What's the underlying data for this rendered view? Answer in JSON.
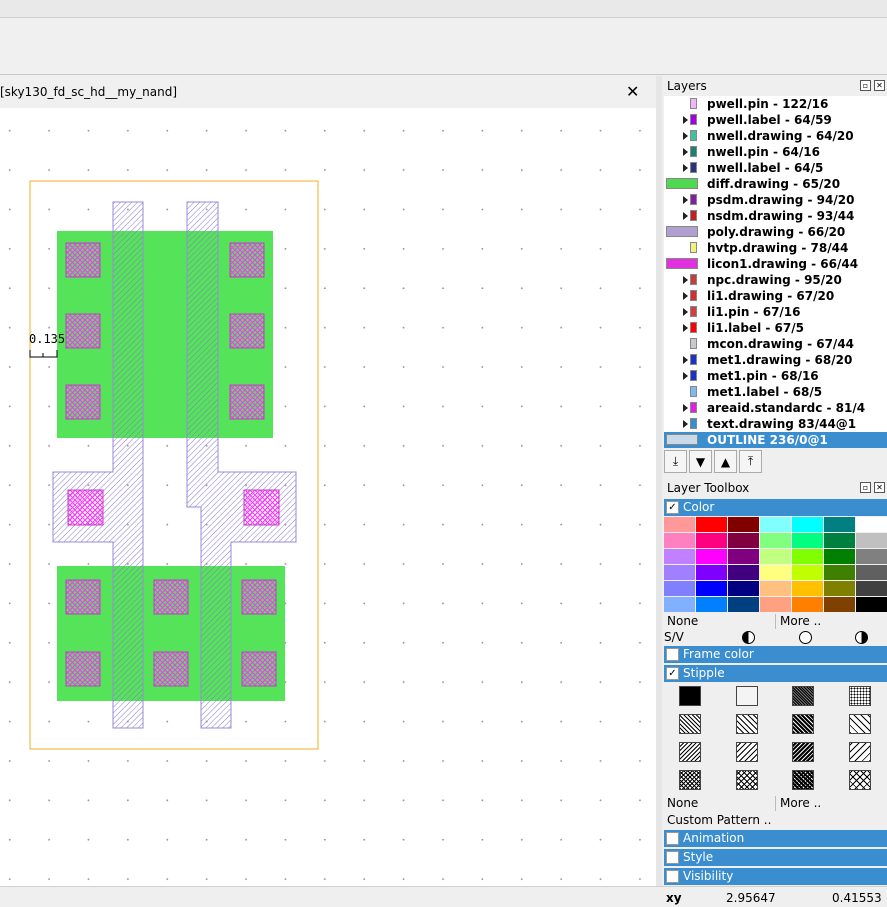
{
  "tab": {
    "title": "[sky130_fd_sc_hd__my_nand]",
    "close": "✕"
  },
  "canvas": {
    "ruler_label": "0.135"
  },
  "layers_panel": {
    "title": "Layers",
    "items": [
      {
        "label": "pwell.pin - 122/16",
        "color": "#f0b8f0",
        "expanded": false
      },
      {
        "label": "pwell.label - 64/59",
        "color": "#a000e0",
        "expanded": true
      },
      {
        "label": "nwell.drawing - 64/20",
        "color": "#40c0a0",
        "expanded": true
      },
      {
        "label": "nwell.pin - 64/16",
        "color": "#208070",
        "expanded": true
      },
      {
        "label": "nwell.label - 64/5",
        "color": "#303080",
        "expanded": true
      },
      {
        "label": "diff.drawing - 65/20",
        "color": "#50d850",
        "expanded": false
      },
      {
        "label": "psdm.drawing - 94/20",
        "color": "#8020a0",
        "expanded": true
      },
      {
        "label": "nsdm.drawing - 93/44",
        "color": "#c02020",
        "expanded": true
      },
      {
        "label": "poly.drawing - 66/20",
        "color": "#b0a0d0",
        "expanded": false
      },
      {
        "label": "hvtp.drawing - 78/44",
        "color": "#f0f080",
        "expanded": false
      },
      {
        "label": "licon1.drawing - 66/44",
        "color": "#e030e0",
        "expanded": false
      },
      {
        "label": "npc.drawing - 95/20",
        "color": "#c04040",
        "expanded": true
      },
      {
        "label": "li1.drawing - 67/20",
        "color": "#d03030",
        "expanded": true
      },
      {
        "label": "li1.pin - 67/16",
        "color": "#d04040",
        "expanded": true
      },
      {
        "label": "li1.label - 67/5",
        "color": "#ff0000",
        "expanded": true
      },
      {
        "label": "mcon.drawing - 67/44",
        "color": "#c8c8d0",
        "expanded": false
      },
      {
        "label": "met1.drawing - 68/20",
        "color": "#2030c0",
        "expanded": true
      },
      {
        "label": "met1.pin - 68/16",
        "color": "#2030c0",
        "expanded": true
      },
      {
        "label": "met1.label - 68/5",
        "color": "#80b8f0",
        "expanded": false
      },
      {
        "label": "areaid.standardc - 81/4",
        "color": "#e020e0",
        "expanded": true
      },
      {
        "label": "text.drawing 83/44@1",
        "color": "#3090d0",
        "expanded": true
      },
      {
        "label": "OUTLINE 236/0@1",
        "color": "#c8daea",
        "expanded": false,
        "selected": true
      }
    ]
  },
  "nav": [
    "move-to-bottom",
    "move-down",
    "move-up",
    "move-to-top"
  ],
  "toolbox": {
    "title": "Layer Toolbox",
    "color_label": "Color",
    "color_checked": true,
    "palette": [
      [
        "#ff9999",
        "#ff0000",
        "#800000",
        "#80ffff",
        "#00ffff",
        "#008080",
        "#ffffff"
      ],
      [
        "#ff80c0",
        "#ff0080",
        "#800040",
        "#80ff80",
        "#00ff80",
        "#008040",
        "#c0c0c0"
      ],
      [
        "#c080ff",
        "#ff00ff",
        "#800080",
        "#c0ff80",
        "#80ff00",
        "#008000",
        "#808080"
      ],
      [
        "#a080ff",
        "#8000ff",
        "#400080",
        "#ffff80",
        "#c0ff00",
        "#408000",
        "#606060"
      ],
      [
        "#8080ff",
        "#0000ff",
        "#000080",
        "#ffc080",
        "#ffc000",
        "#808000",
        "#404040"
      ],
      [
        "#80b0ff",
        "#0080ff",
        "#004080",
        "#ffa080",
        "#ff8000",
        "#804000",
        "#000000"
      ]
    ],
    "none_label": "None",
    "more_label": "More ..",
    "sv_label": "S/V",
    "frame_color_label": "Frame color",
    "frame_color_checked": false,
    "stipple_label": "Stipple",
    "stipple_checked": true,
    "stipple_none_label": "None",
    "stipple_more_label": "More ..",
    "custom_pattern_label": "Custom Pattern ..",
    "animation_label": "Animation",
    "style_label": "Style",
    "visibility_label": "Visibility"
  },
  "status": {
    "xy_label": "xy",
    "x": "2.95647",
    "y": "0.41553"
  },
  "colors": {
    "selection": "#3a8ed0",
    "diff": "#55e35a",
    "poly": "#9888d8",
    "licon": "#d040d0",
    "outline": "#f0b020"
  }
}
